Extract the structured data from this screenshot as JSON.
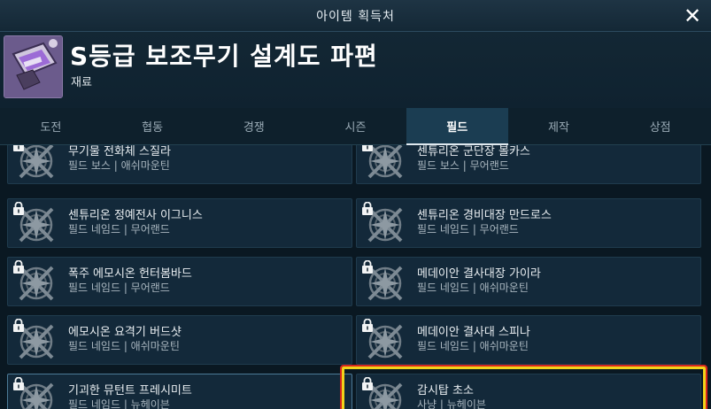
{
  "window": {
    "title": "아이템 획득처",
    "close_glyph": "✕"
  },
  "item": {
    "name": "S등급 보조무기 설계도 파편",
    "type": "재료",
    "icon": "blueprint-fragment-icon"
  },
  "tabs": [
    {
      "label": "도전",
      "active": false
    },
    {
      "label": "협동",
      "active": false
    },
    {
      "label": "경쟁",
      "active": false
    },
    {
      "label": "시즌",
      "active": false
    },
    {
      "label": "필드",
      "active": true
    },
    {
      "label": "제작",
      "active": false
    },
    {
      "label": "상점",
      "active": false
    }
  ],
  "entries": [
    {
      "name": "무기물 전화체 스질라",
      "sub": "필드 보스 | 애쉬마운틴"
    },
    {
      "name": "센튜리온 군단장 볼카스",
      "sub": "필드 보스 | 무어랜드"
    },
    {
      "name": "센튜리온 정예전사 이그니스",
      "sub": "필드 네임드 | 무어랜드"
    },
    {
      "name": "센튜리온 경비대장 만드로스",
      "sub": "필드 네임드 | 무어랜드"
    },
    {
      "name": "폭주 에모시온 헌터봄바드",
      "sub": "필드 네임드 | 무어랜드"
    },
    {
      "name": "메데이안 결사대장 가이라",
      "sub": "필드 네임드 | 애쉬마운틴"
    },
    {
      "name": "에모시온 요격기 버드샷",
      "sub": "필드 네임드 | 애쉬마운틴"
    },
    {
      "name": "메데이안 결사대 스피나",
      "sub": "필드 네임드 | 애쉬마운틴"
    },
    {
      "name": "기괴한 뮤턴트 프레시미트",
      "sub": "필드 네임드 | 뉴헤이븐"
    },
    {
      "name": "감시탑 초소",
      "sub": "사냥 | 뉴헤이븐"
    }
  ],
  "colors": {
    "highlight_border": "#f2d31a",
    "highlight_outline": "#d7261e",
    "active_tab": "#1b3d52"
  }
}
